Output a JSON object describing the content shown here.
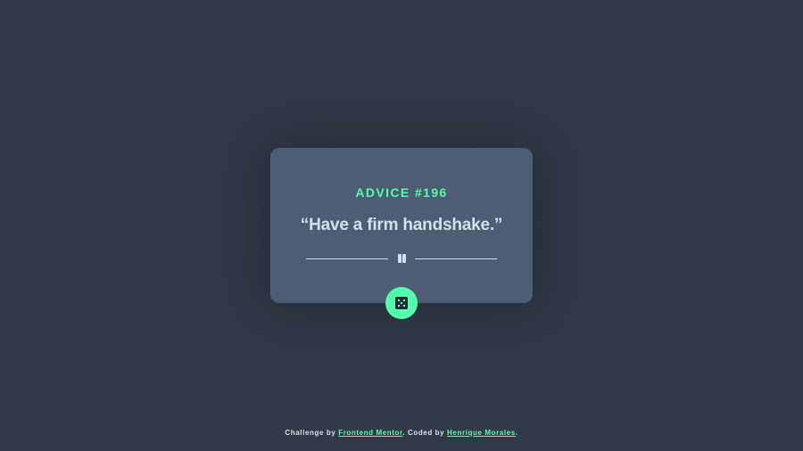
{
  "card": {
    "advice_id": "ADVICE #196",
    "advice_text": "“Have a firm handshake.”"
  },
  "icons": {
    "divider": "pause-icon",
    "button": "dice-icon"
  },
  "footer": {
    "prefix": "Challenge by ",
    "link1": "Frontend Mentor",
    "middle": ". Coded by ",
    "link2": "Henrique Morales",
    "suffix": "."
  },
  "colors": {
    "background": "#323a49",
    "card": "#4e5d73",
    "accent": "#53ffaa",
    "text": "#cee3e9"
  }
}
